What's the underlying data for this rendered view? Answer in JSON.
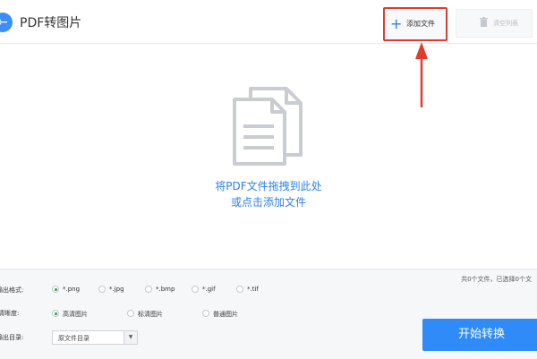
{
  "header": {
    "title": "PDF转图片",
    "back_icon": "arrow-left-icon",
    "add_files_label": "添加文件",
    "clear_list_label": "清空列表"
  },
  "dropzone": {
    "line1": "将PDF文件拖拽到此处",
    "line2": "或点击添加文件",
    "icon": "documents-icon"
  },
  "settings": {
    "file_count": "共0个文件，已选择0个文",
    "format": {
      "label": "输出格式:",
      "options": [
        {
          "label": "*.png",
          "selected": true
        },
        {
          "label": "*.jpg",
          "selected": false
        },
        {
          "label": "*.bmp",
          "selected": false
        },
        {
          "label": "*.gif",
          "selected": false
        },
        {
          "label": "*.tif",
          "selected": false
        }
      ]
    },
    "quality": {
      "label": "清晰度:",
      "options": [
        {
          "label": "高清图片",
          "selected": true
        },
        {
          "label": "标清图片",
          "selected": false
        },
        {
          "label": "普通图片",
          "selected": false
        }
      ]
    },
    "output": {
      "label": "输出目录:",
      "value": "原文件目录"
    },
    "start_label": "开始转换"
  },
  "colors": {
    "accent": "#2f8bf7",
    "highlight": "#e03b2f",
    "selected_radio": "#2b9a4a"
  }
}
